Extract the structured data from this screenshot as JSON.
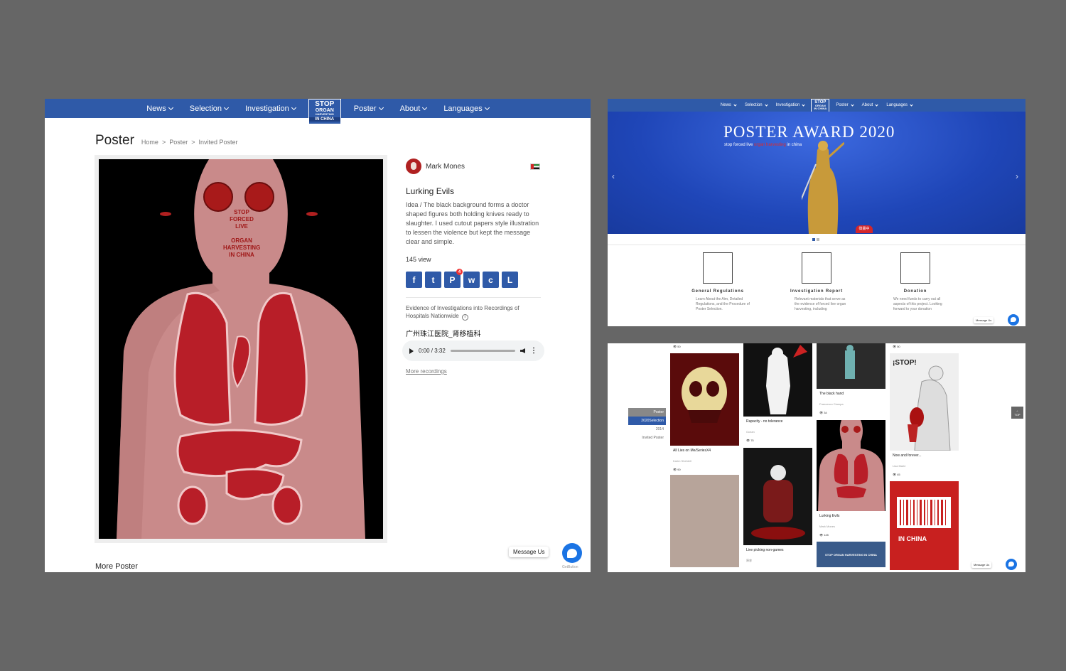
{
  "nav": {
    "items": [
      "News",
      "Selection",
      "Investigation",
      "Poster",
      "About",
      "Languages"
    ],
    "logo": {
      "line1": "STOP",
      "line2": "ORGAN",
      "line3": "HARVESTING",
      "line4": "IN CHINA"
    }
  },
  "detail": {
    "page_title": "Poster",
    "breadcrumb": {
      "home": "Home",
      "sep": ">",
      "section": "Poster",
      "current": "Invited Poster"
    },
    "artist": "Mark Mones",
    "poster_text": {
      "l1": "STOP",
      "l2": "FORCED",
      "l3": "LIVE",
      "l4": "ORGAN",
      "l5": "HARVESTING",
      "l6": "IN CHINA"
    },
    "title": "Lurking Evils",
    "description": "Idea / The black background forms a doctor shaped figures both holding knives ready to slaughter. I used cutout papers style illustration to lessen the violence but kept the message clear and simple.",
    "views": "145 view",
    "share": [
      {
        "icon": "facebook-icon",
        "glyph": "f"
      },
      {
        "icon": "twitter-icon",
        "glyph": "t"
      },
      {
        "icon": "pinterest-icon",
        "glyph": "P",
        "badge": "4"
      },
      {
        "icon": "whatsapp-icon",
        "glyph": "w"
      },
      {
        "icon": "wechat-icon",
        "glyph": "c"
      },
      {
        "icon": "line-icon",
        "glyph": "L"
      }
    ],
    "evidence": "Evidence of Investigations into Recordings of Hospitals Nationwide",
    "recording_title": "广州珠江医院_肾移植科",
    "audio_time": "0:00 / 3:32",
    "more_recordings": "More recordings",
    "more_poster": "More Poster",
    "message_us": "Message Us",
    "getbutton": "GetButton"
  },
  "home": {
    "hero_title": "POSTER AWARD 2020",
    "hero_sub_before": "stop forced live ",
    "hero_sub_red": "organ harvesting",
    "hero_sub_after": " in china",
    "hero_badge": "徵畫中",
    "features": [
      {
        "icon": "map-icon",
        "name": "General Regulations",
        "desc": "Learn About the Aim, Detailed Regulations, and the Procedure of Poster Selection."
      },
      {
        "icon": "magnifier-icon",
        "name": "Investigation Report",
        "desc": "Relevant materials that serve as the evidence of forced live organ harvesting, including"
      },
      {
        "icon": "donation-icon",
        "name": "Donation",
        "desc": "We need funds to carry out all aspects of this project. Looking forward to your donation"
      }
    ],
    "message_us": "Message Us"
  },
  "grid": {
    "side_menu": [
      "Poster",
      "2020Selection",
      "2014",
      "Invited Poster"
    ],
    "top_label": "TOP",
    "message_us": "Message Us",
    "columns": [
      {
        "top_views": "50",
        "cards": [
          {
            "title": "All Lies on Me/SeriesX4",
            "author": "Karim Shehlell",
            "views": "90",
            "color": "#6a0f0f"
          },
          {
            "title": "",
            "author": "",
            "views": "",
            "color": "#b5a69c"
          }
        ]
      },
      {
        "top_views": "",
        "cards": [
          {
            "title": "Rapacity - no tolerance",
            "author": "Ocean",
            "views": "75",
            "color": "#111111"
          },
          {
            "title": "Live picking non-games",
            "author": "陳睿",
            "views": "",
            "color": "#141414"
          }
        ]
      },
      {
        "top_views": "",
        "cards": [
          {
            "title": "The black hand",
            "author": "Francesco Ciampa",
            "views": "34",
            "color": "#2a2a2a"
          },
          {
            "title": "Lurking Evils",
            "author": "Mark Mones",
            "views": "145",
            "color": "#000000"
          },
          {
            "title": "",
            "author": "",
            "views": "",
            "color": "#3a5b8a",
            "text": "STOP ORGAN HARVESTING IN CHINA"
          }
        ]
      },
      {
        "top_views": "50",
        "cards": [
          {
            "title": "Now and forever...",
            "author": "Lisa Marie",
            "views": "45",
            "color": "#f0f0f0",
            "text": "¡STOP!"
          },
          {
            "title": "",
            "author": "",
            "views": "",
            "color": "#c8201f",
            "text": "IN CHINA"
          }
        ]
      }
    ]
  }
}
